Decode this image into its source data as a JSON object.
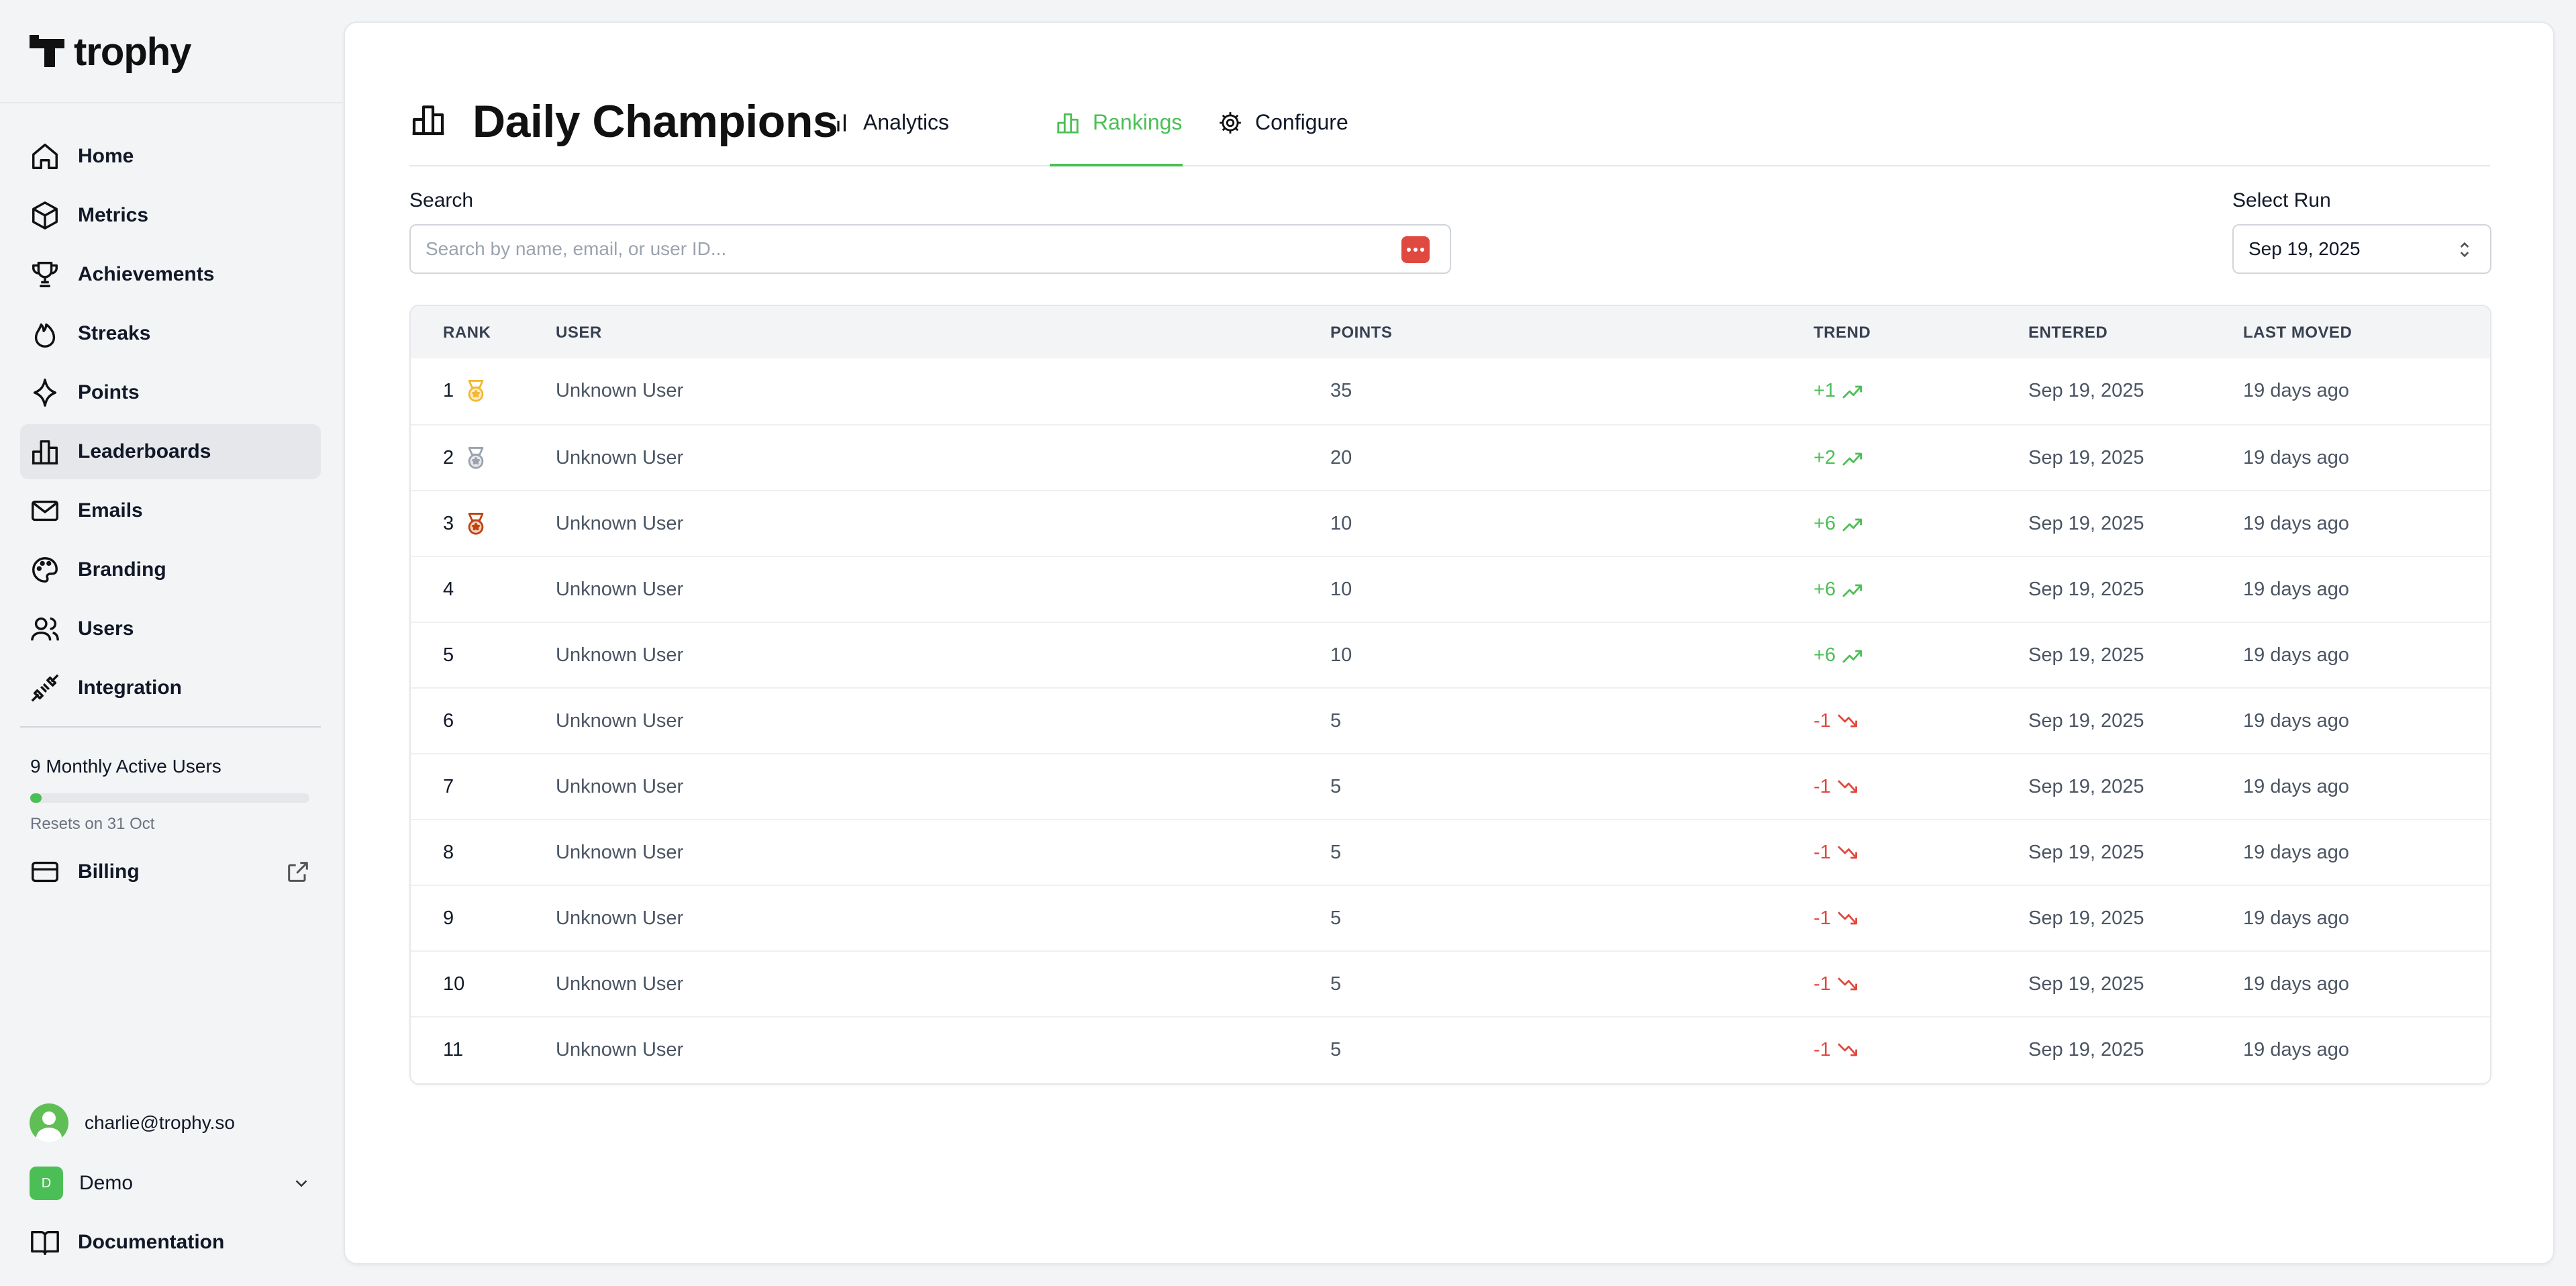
{
  "app": {
    "name": "trophy"
  },
  "sidebar": {
    "items": [
      {
        "label": "Home",
        "icon": "home-icon"
      },
      {
        "label": "Metrics",
        "icon": "cube-icon"
      },
      {
        "label": "Achievements",
        "icon": "trophy-icon"
      },
      {
        "label": "Streaks",
        "icon": "flame-icon"
      },
      {
        "label": "Points",
        "icon": "sparkle-icon"
      },
      {
        "label": "Leaderboards",
        "icon": "bar-chart-icon",
        "active": true
      },
      {
        "label": "Emails",
        "icon": "mail-icon"
      },
      {
        "label": "Branding",
        "icon": "palette-icon"
      },
      {
        "label": "Users",
        "icon": "users-icon"
      },
      {
        "label": "Integration",
        "icon": "plug-icon"
      }
    ],
    "usage": {
      "label": "9 Monthly Active Users",
      "fill_fraction": 0.04,
      "resets": "Resets on 31 Oct"
    },
    "billing": {
      "label": "Billing"
    },
    "account": {
      "email": "charlie@trophy.so"
    },
    "org": {
      "badge": "D",
      "name": "Demo"
    },
    "documentation": {
      "label": "Documentation"
    }
  },
  "header": {
    "title": "Daily Champions",
    "tabs": [
      {
        "label": "Analytics",
        "icon": "bar-chart-icon"
      },
      {
        "label": "Rankings",
        "icon": "podium-icon",
        "active": true
      },
      {
        "label": "Configure",
        "icon": "gear-icon"
      }
    ]
  },
  "search": {
    "label": "Search",
    "placeholder": "Search by name, email, or user ID..."
  },
  "run": {
    "label": "Select Run",
    "value": "Sep 19, 2025"
  },
  "table": {
    "columns": [
      "RANK",
      "USER",
      "POINTS",
      "TREND",
      "ENTERED",
      "LAST MOVED"
    ],
    "rows": [
      {
        "rank": "1",
        "medal": "gold",
        "user": "Unknown User",
        "points": "35",
        "trend": "+1",
        "direction": "up",
        "entered": "Sep 19, 2025",
        "moved": "19 days ago"
      },
      {
        "rank": "2",
        "medal": "silver",
        "user": "Unknown User",
        "points": "20",
        "trend": "+2",
        "direction": "up",
        "entered": "Sep 19, 2025",
        "moved": "19 days ago"
      },
      {
        "rank": "3",
        "medal": "bronze",
        "user": "Unknown User",
        "points": "10",
        "trend": "+6",
        "direction": "up",
        "entered": "Sep 19, 2025",
        "moved": "19 days ago"
      },
      {
        "rank": "4",
        "medal": "",
        "user": "Unknown User",
        "points": "10",
        "trend": "+6",
        "direction": "up",
        "entered": "Sep 19, 2025",
        "moved": "19 days ago"
      },
      {
        "rank": "5",
        "medal": "",
        "user": "Unknown User",
        "points": "10",
        "trend": "+6",
        "direction": "up",
        "entered": "Sep 19, 2025",
        "moved": "19 days ago"
      },
      {
        "rank": "6",
        "medal": "",
        "user": "Unknown User",
        "points": "5",
        "trend": "-1",
        "direction": "down",
        "entered": "Sep 19, 2025",
        "moved": "19 days ago"
      },
      {
        "rank": "7",
        "medal": "",
        "user": "Unknown User",
        "points": "5",
        "trend": "-1",
        "direction": "down",
        "entered": "Sep 19, 2025",
        "moved": "19 days ago"
      },
      {
        "rank": "8",
        "medal": "",
        "user": "Unknown User",
        "points": "5",
        "trend": "-1",
        "direction": "down",
        "entered": "Sep 19, 2025",
        "moved": "19 days ago"
      },
      {
        "rank": "9",
        "medal": "",
        "user": "Unknown User",
        "points": "5",
        "trend": "-1",
        "direction": "down",
        "entered": "Sep 19, 2025",
        "moved": "19 days ago"
      },
      {
        "rank": "10",
        "medal": "",
        "user": "Unknown User",
        "points": "5",
        "trend": "-1",
        "direction": "down",
        "entered": "Sep 19, 2025",
        "moved": "19 days ago"
      },
      {
        "rank": "11",
        "medal": "",
        "user": "Unknown User",
        "points": "5",
        "trend": "-1",
        "direction": "down",
        "entered": "Sep 19, 2025",
        "moved": "19 days ago"
      }
    ]
  },
  "colors": {
    "accent": "#4bbf55",
    "negative": "#e0493f",
    "gold": "#f5b82e",
    "silver": "#9ca3af",
    "bronze": "#c2410c"
  }
}
